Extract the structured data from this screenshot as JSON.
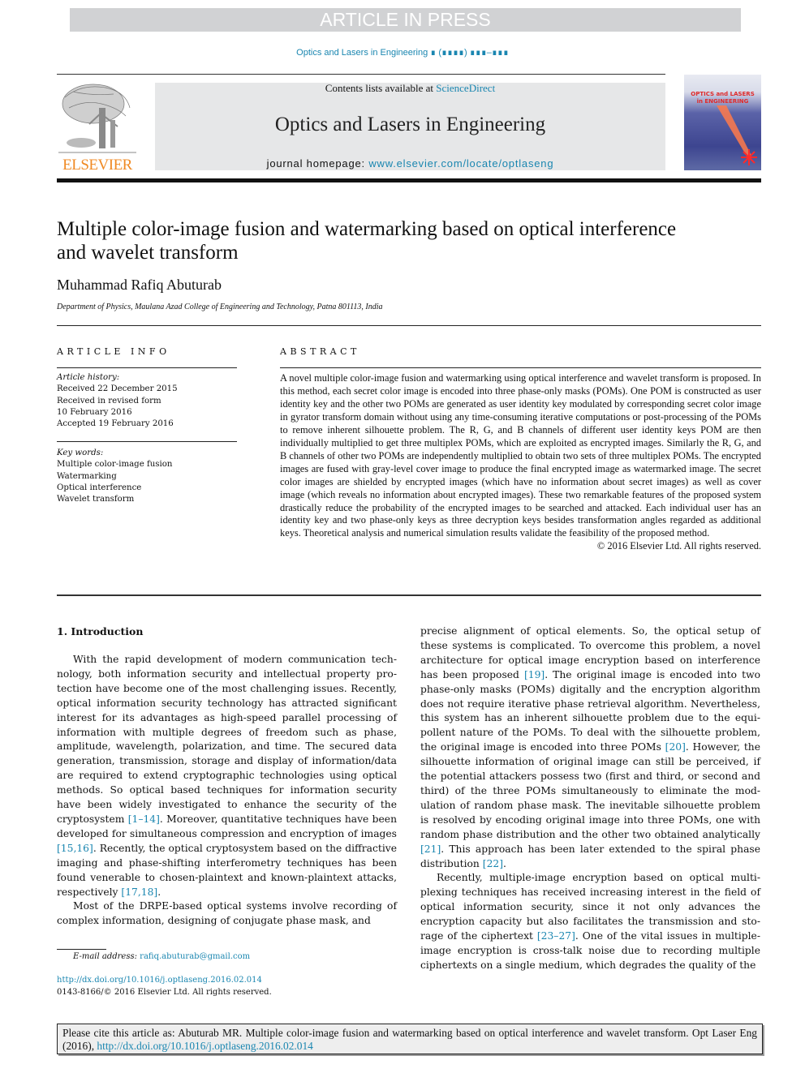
{
  "banner": {
    "text": "ARTICLE IN PRESS"
  },
  "running_head": {
    "journal": "Optics and Lasers in Engineering",
    "issue_placeholder": "∎ (∎∎∎∎) ∎∎∎–∎∎∎"
  },
  "masthead": {
    "publisher_logo": "ELSEVIER",
    "contents_prefix": "Contents lists available at ",
    "contents_link": "ScienceDirect",
    "journal_title": "Optics and Lasers in Engineering",
    "homepage_prefix": "journal homepage: ",
    "homepage_link": "www.elsevier.com/locate/optlaseng",
    "cover_title_line1": "OPTICS and LASERS",
    "cover_title_line2": "in ENGINEERING"
  },
  "article": {
    "title": "Multiple color-image fusion and watermarking based on optical interference and wavelet transform",
    "author": "Muhammad Rafiq Abuturab",
    "affiliation": "Department of Physics, Maulana Azad College of Engineering and Technology, Patna 801113, India"
  },
  "article_info": {
    "heading": "ARTICLE INFO",
    "history_label": "Article history:",
    "history": [
      "Received 22 December 2015",
      "Received in revised form",
      "10 February 2016",
      "Accepted 19 February 2016"
    ],
    "keywords_label": "Key words:",
    "keywords": [
      "Multiple color-image fusion",
      "Watermarking",
      "Optical interference",
      "Wavelet transform"
    ]
  },
  "abstract": {
    "heading": "ABSTRACT",
    "text": "A novel multiple color-image fusion and watermarking using optical interference and wavelet transform is proposed. In this method, each secret color image is encoded into three phase-only masks (POMs). One POM is constructed as user identity key and the other two POMs are generated as user identity key modulated by corresponding secret color image in gyrator transform domain without using any time-consuming iterative computations or post-processing of the POMs to remove inherent silhouette problem. The R, G, and B channels of different user identity keys POM are then individually multiplied to get three multiplex POMs, which are exploited as encrypted images. Similarly the R, G, and B channels of other two POMs are independently multiplied to obtain two sets of three multiplex POMs. The encrypted images are fused with gray-level cover image to produce the final encrypted image as watermarked image. The secret color images are shielded by encrypted images (which have no information about secret images) as well as cover image (which reveals no information about encrypted images). These two remarkable features of the proposed system drastically reduce the probability of the encrypted images to be searched and attacked. Each individual user has an identity key and two phase-only keys as three decryption keys besides transformation angles regarded as additional keys. Theoretical analysis and numerical simulation results validate the feasibility of the proposed method.",
    "copyright": "© 2016 Elsevier Ltd. All rights reserved."
  },
  "introduction": {
    "heading": "1.  Introduction",
    "left_p1_a": "With the rapid development of modern communication tech­nology, both information security and intellectual property pro­tection have become one of the most challenging issues. Recently, optical information security technology has attracted significant interest for its advantages as high-speed parallel processing of information with multiple degrees of freedom such as phase, amplitude, wavelength, polarization, and time. The secured data generation, transmission, storage and display of information/data are required to extend cryptographic technologies using optical methods. So optical based techniques for information security have been widely investigated to enhance the security of the cryptosystem ",
    "ref_1_14": "[1–14]",
    "left_p1_b": ". Moreover, quantitative techniques have been developed for simultaneous compression and encryption of ima­ges ",
    "ref_15_16": "[15,16]",
    "left_p1_c": ". Recently, the optical cryptosystem based on the dif­fractive imaging and phase-shifting interferometry techniques has been found venerable to chosen-plaintext and known-plaintext attacks, respectively ",
    "ref_17_18": "[17,18]",
    "left_p1_d": ".",
    "left_p2": "Most of the DRPE-based optical systems involve recording of complex information, designing of conjugate phase mask, and",
    "right_p1_a": "precise alignment of optical elements. So, the optical setup of these systems is complicated. To overcome this problem, a novel architecture for optical image encryption based on interference has been proposed ",
    "ref_19": "[19]",
    "right_p1_b": ". The original image is encoded into two phase-only masks (POMs) digitally and the encryption algorithm does not require iterative phase retrieval algorithm. Nevertheless, this system has an inherent silhouette problem due to the equi­pollent nature of the POMs. To deal with the silhouette problem, the original image is encoded into three POMs ",
    "ref_20": "[20]",
    "right_p1_c": ". However, the silhouette information of original image can still be perceived, if the potential attackers possess two (first and third, or second and third) of the three POMs simultaneously to eliminate the mod­ulation of random phase mask. The inevitable silhouette problem is resolved by encoding original image into three POMs, one with random phase distribution and the other two obtained analytically ",
    "ref_21": "[21]",
    "right_p1_d": ". This approach has been later extended to the spiral phase distribution ",
    "ref_22": "[22]",
    "right_p1_e": ".",
    "right_p2_a": "Recently, multiple-image encryption based on optical multi­plexing techniques has received increasing interest in the field of optical information security, since it not only advances the encryption capacity but also facilitates the transmission and sto­rage of the ciphertext ",
    "ref_23_27": "[23–27]",
    "right_p2_b": ". One of the vital issues in multiple-image encryption is cross-talk noise due to recording multiple ciphertexts on a single medium, which degrades the quality of the"
  },
  "footnote": {
    "email_label": "E-mail address: ",
    "email": "rafiq.abuturab@gmail.com",
    "doi": "http://dx.doi.org/10.1016/j.optlaseng.2016.02.014",
    "issn_copyright": "0143-8166/© 2016 Elsevier Ltd. All rights reserved."
  },
  "citation_box": {
    "text": "Please cite this article as: Abuturab MR. Multiple color-image fusion and watermarking based on optical interference and wavelet transform. Opt Laser Eng (2016), ",
    "link": "http://dx.doi.org/10.1016/j.optlaseng.2016.02.014"
  }
}
